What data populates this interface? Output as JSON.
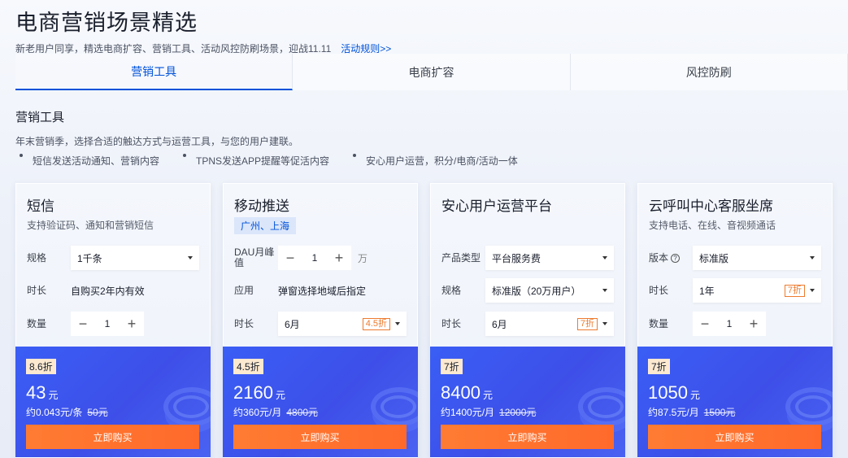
{
  "hero": {
    "title": "电商营销场景精选",
    "subtitle": "新老用户同享，精选电商扩容、营销工具、活动风控防刷场景，迎战11.11",
    "rules_link": "活动规则>>"
  },
  "tabs": [
    {
      "label": "营销工具",
      "active": true
    },
    {
      "label": "电商扩容",
      "active": false
    },
    {
      "label": "风控防刷",
      "active": false
    }
  ],
  "section": {
    "title": "营销工具",
    "desc": "年末营销季，选择合适的触达方式与运营工具，与您的用户建联。",
    "bullets": [
      "短信发送活动通知、营销内容",
      "TPNS发送APP提醒等促活内容",
      "安心用户运营，积分/电商/活动一体"
    ]
  },
  "cards": [
    {
      "title": "短信",
      "subtitle": "支持验证码、通知和营销短信",
      "spec_label": "规格",
      "spec_value": "1千条",
      "duration_label": "时长",
      "duration_value": "自购买2年内有效",
      "qty_label": "数量",
      "qty": "1",
      "discount": "8.6折",
      "price": "43",
      "price_unit": "元",
      "per": "约0.043元/条",
      "orig": "50元",
      "buy": "立即购买"
    },
    {
      "title": "移动推送",
      "tag": "广州、上海",
      "dau_label": "DAU月峰值",
      "dau": "1",
      "dau_unit": "万",
      "app_label": "应用",
      "app_value": "弹窗选择地域后指定",
      "duration_label": "时长",
      "duration_value": "6月",
      "duration_discount": "4.5折",
      "discount": "4.5折",
      "price": "2160",
      "price_unit": "元",
      "per": "约360元/月",
      "orig": "4800元",
      "buy": "立即购买"
    },
    {
      "title": "安心用户运营平台",
      "type_label": "产品类型",
      "type_value": "平台服务费",
      "spec_label": "规格",
      "spec_value": "标准版（20万用户）",
      "duration_label": "时长",
      "duration_value": "6月",
      "duration_discount": "7折",
      "discount": "7折",
      "price": "8400",
      "price_unit": "元",
      "per": "约1400元/月",
      "orig": "12000元",
      "buy": "立即购买"
    },
    {
      "title": "云呼叫中心客服坐席",
      "subtitle": "支持电话、在线、音视频通话",
      "version_label": "版本",
      "version_value": "标准版",
      "duration_label": "时长",
      "duration_value": "1年",
      "duration_discount": "7折",
      "qty_label": "数量",
      "qty": "1",
      "discount": "7折",
      "price": "1050",
      "price_unit": "元",
      "per": "约87.5元/月",
      "orig": "1500元",
      "buy": "立即购买"
    }
  ],
  "colors": {
    "accent": "#0052d9",
    "price_bg": "#3d52ea",
    "buy": "#ff6f2e",
    "discount": "#ed7b2f"
  }
}
